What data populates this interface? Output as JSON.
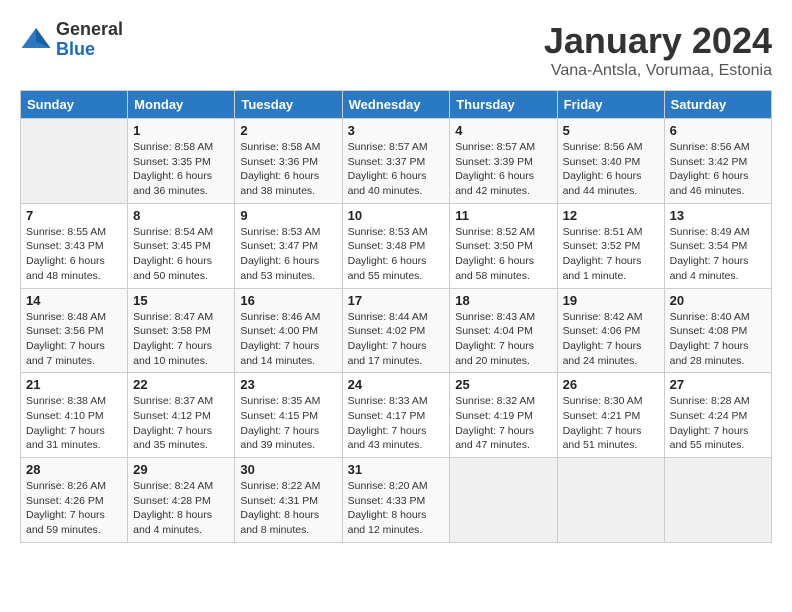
{
  "logo": {
    "general": "General",
    "blue": "Blue"
  },
  "header": {
    "month": "January 2024",
    "location": "Vana-Antsla, Vorumaa, Estonia"
  },
  "weekdays": [
    "Sunday",
    "Monday",
    "Tuesday",
    "Wednesday",
    "Thursday",
    "Friday",
    "Saturday"
  ],
  "weeks": [
    [
      {
        "day": "",
        "sunrise": "",
        "sunset": "",
        "daylight": ""
      },
      {
        "day": "1",
        "sunrise": "Sunrise: 8:58 AM",
        "sunset": "Sunset: 3:35 PM",
        "daylight": "Daylight: 6 hours and 36 minutes."
      },
      {
        "day": "2",
        "sunrise": "Sunrise: 8:58 AM",
        "sunset": "Sunset: 3:36 PM",
        "daylight": "Daylight: 6 hours and 38 minutes."
      },
      {
        "day": "3",
        "sunrise": "Sunrise: 8:57 AM",
        "sunset": "Sunset: 3:37 PM",
        "daylight": "Daylight: 6 hours and 40 minutes."
      },
      {
        "day": "4",
        "sunrise": "Sunrise: 8:57 AM",
        "sunset": "Sunset: 3:39 PM",
        "daylight": "Daylight: 6 hours and 42 minutes."
      },
      {
        "day": "5",
        "sunrise": "Sunrise: 8:56 AM",
        "sunset": "Sunset: 3:40 PM",
        "daylight": "Daylight: 6 hours and 44 minutes."
      },
      {
        "day": "6",
        "sunrise": "Sunrise: 8:56 AM",
        "sunset": "Sunset: 3:42 PM",
        "daylight": "Daylight: 6 hours and 46 minutes."
      }
    ],
    [
      {
        "day": "7",
        "sunrise": "Sunrise: 8:55 AM",
        "sunset": "Sunset: 3:43 PM",
        "daylight": "Daylight: 6 hours and 48 minutes."
      },
      {
        "day": "8",
        "sunrise": "Sunrise: 8:54 AM",
        "sunset": "Sunset: 3:45 PM",
        "daylight": "Daylight: 6 hours and 50 minutes."
      },
      {
        "day": "9",
        "sunrise": "Sunrise: 8:53 AM",
        "sunset": "Sunset: 3:47 PM",
        "daylight": "Daylight: 6 hours and 53 minutes."
      },
      {
        "day": "10",
        "sunrise": "Sunrise: 8:53 AM",
        "sunset": "Sunset: 3:48 PM",
        "daylight": "Daylight: 6 hours and 55 minutes."
      },
      {
        "day": "11",
        "sunrise": "Sunrise: 8:52 AM",
        "sunset": "Sunset: 3:50 PM",
        "daylight": "Daylight: 6 hours and 58 minutes."
      },
      {
        "day": "12",
        "sunrise": "Sunrise: 8:51 AM",
        "sunset": "Sunset: 3:52 PM",
        "daylight": "Daylight: 7 hours and 1 minute."
      },
      {
        "day": "13",
        "sunrise": "Sunrise: 8:49 AM",
        "sunset": "Sunset: 3:54 PM",
        "daylight": "Daylight: 7 hours and 4 minutes."
      }
    ],
    [
      {
        "day": "14",
        "sunrise": "Sunrise: 8:48 AM",
        "sunset": "Sunset: 3:56 PM",
        "daylight": "Daylight: 7 hours and 7 minutes."
      },
      {
        "day": "15",
        "sunrise": "Sunrise: 8:47 AM",
        "sunset": "Sunset: 3:58 PM",
        "daylight": "Daylight: 7 hours and 10 minutes."
      },
      {
        "day": "16",
        "sunrise": "Sunrise: 8:46 AM",
        "sunset": "Sunset: 4:00 PM",
        "daylight": "Daylight: 7 hours and 14 minutes."
      },
      {
        "day": "17",
        "sunrise": "Sunrise: 8:44 AM",
        "sunset": "Sunset: 4:02 PM",
        "daylight": "Daylight: 7 hours and 17 minutes."
      },
      {
        "day": "18",
        "sunrise": "Sunrise: 8:43 AM",
        "sunset": "Sunset: 4:04 PM",
        "daylight": "Daylight: 7 hours and 20 minutes."
      },
      {
        "day": "19",
        "sunrise": "Sunrise: 8:42 AM",
        "sunset": "Sunset: 4:06 PM",
        "daylight": "Daylight: 7 hours and 24 minutes."
      },
      {
        "day": "20",
        "sunrise": "Sunrise: 8:40 AM",
        "sunset": "Sunset: 4:08 PM",
        "daylight": "Daylight: 7 hours and 28 minutes."
      }
    ],
    [
      {
        "day": "21",
        "sunrise": "Sunrise: 8:38 AM",
        "sunset": "Sunset: 4:10 PM",
        "daylight": "Daylight: 7 hours and 31 minutes."
      },
      {
        "day": "22",
        "sunrise": "Sunrise: 8:37 AM",
        "sunset": "Sunset: 4:12 PM",
        "daylight": "Daylight: 7 hours and 35 minutes."
      },
      {
        "day": "23",
        "sunrise": "Sunrise: 8:35 AM",
        "sunset": "Sunset: 4:15 PM",
        "daylight": "Daylight: 7 hours and 39 minutes."
      },
      {
        "day": "24",
        "sunrise": "Sunrise: 8:33 AM",
        "sunset": "Sunset: 4:17 PM",
        "daylight": "Daylight: 7 hours and 43 minutes."
      },
      {
        "day": "25",
        "sunrise": "Sunrise: 8:32 AM",
        "sunset": "Sunset: 4:19 PM",
        "daylight": "Daylight: 7 hours and 47 minutes."
      },
      {
        "day": "26",
        "sunrise": "Sunrise: 8:30 AM",
        "sunset": "Sunset: 4:21 PM",
        "daylight": "Daylight: 7 hours and 51 minutes."
      },
      {
        "day": "27",
        "sunrise": "Sunrise: 8:28 AM",
        "sunset": "Sunset: 4:24 PM",
        "daylight": "Daylight: 7 hours and 55 minutes."
      }
    ],
    [
      {
        "day": "28",
        "sunrise": "Sunrise: 8:26 AM",
        "sunset": "Sunset: 4:26 PM",
        "daylight": "Daylight: 7 hours and 59 minutes."
      },
      {
        "day": "29",
        "sunrise": "Sunrise: 8:24 AM",
        "sunset": "Sunset: 4:28 PM",
        "daylight": "Daylight: 8 hours and 4 minutes."
      },
      {
        "day": "30",
        "sunrise": "Sunrise: 8:22 AM",
        "sunset": "Sunset: 4:31 PM",
        "daylight": "Daylight: 8 hours and 8 minutes."
      },
      {
        "day": "31",
        "sunrise": "Sunrise: 8:20 AM",
        "sunset": "Sunset: 4:33 PM",
        "daylight": "Daylight: 8 hours and 12 minutes."
      },
      {
        "day": "",
        "sunrise": "",
        "sunset": "",
        "daylight": ""
      },
      {
        "day": "",
        "sunrise": "",
        "sunset": "",
        "daylight": ""
      },
      {
        "day": "",
        "sunrise": "",
        "sunset": "",
        "daylight": ""
      }
    ]
  ]
}
